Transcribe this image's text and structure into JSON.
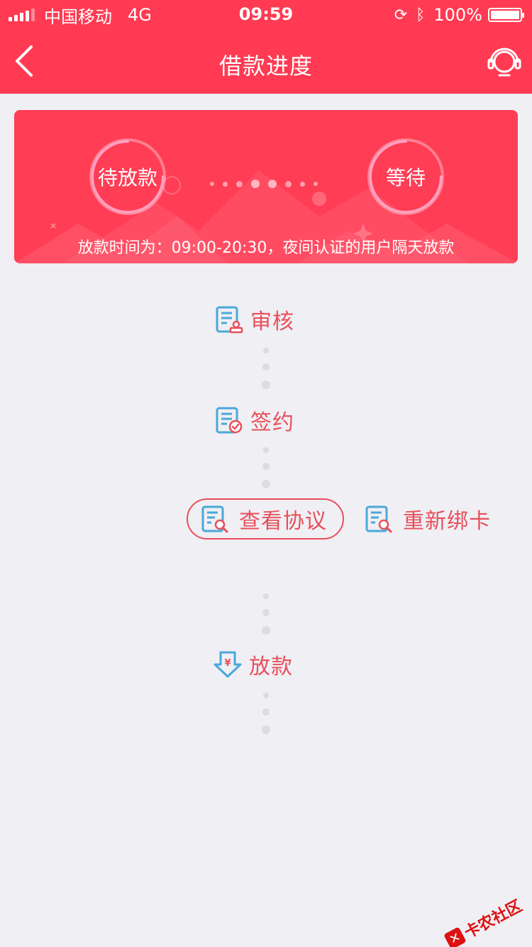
{
  "status_bar": {
    "carrier": "中国移动",
    "network": "4G",
    "time": "09:59",
    "battery": "100%"
  },
  "nav": {
    "title": "借款进度"
  },
  "banner": {
    "current_stage": "待放款",
    "next_stage": "等待",
    "note": "放款时间为：09:00-20:30，夜间认证的用户隔天放款"
  },
  "steps": {
    "review": "审核",
    "sign": "签约",
    "view_agreement": "查看协议",
    "rebind_card": "重新绑卡",
    "disburse": "放款"
  },
  "watermark": "卡农社区",
  "colors": {
    "primary_red": "#ff3a52",
    "step_text": "#e8505b",
    "icon_blue": "#4aa8d8",
    "background": "#efeff4"
  }
}
